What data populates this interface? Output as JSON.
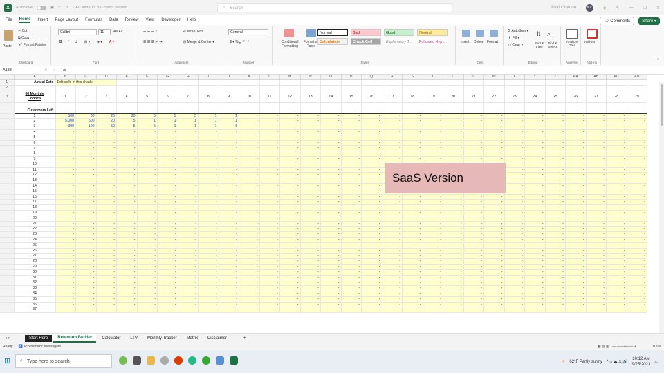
{
  "titlebar": {
    "autosave": "AutoSave",
    "autosave_state": "Off",
    "filename": "CAC and LTV v3 - SaaS Version",
    "search_placeholder": "Search",
    "user_name": "Kevin Vernon",
    "user_initials": "KV"
  },
  "menu": {
    "tabs": [
      "File",
      "Home",
      "Insert",
      "Page Layout",
      "Formulas",
      "Data",
      "Review",
      "View",
      "Developer",
      "Help"
    ],
    "active": "Home",
    "comments": "Comments",
    "share": "Share"
  },
  "ribbon": {
    "clipboard": {
      "label": "Clipboard",
      "paste": "Paste",
      "cut": "Cut",
      "copy": "Copy",
      "format_painter": "Format Painter"
    },
    "font": {
      "label": "Font",
      "name": "Calibri",
      "size": "11"
    },
    "alignment": {
      "label": "Alignment",
      "wrap": "Wrap Text",
      "merge": "Merge & Center"
    },
    "number": {
      "label": "Number",
      "format": "General"
    },
    "styles": {
      "label": "Styles",
      "conditional": "Conditional Formatting",
      "format_as_table": "Format as Table",
      "normal": "Normal",
      "bad": "Bad",
      "good": "Good",
      "neutral": "Neutral",
      "calculation": "Calculation",
      "check_cell": "Check Cell",
      "explanatory": "Explanatory T...",
      "followed": "Followed Hyp..."
    },
    "cells": {
      "label": "Cells",
      "insert": "Insert",
      "delete": "Delete",
      "format": "Format"
    },
    "editing": {
      "label": "Editing",
      "autosum": "AutoSum",
      "fill": "Fill",
      "clear": "Clear",
      "sort": "Sort & Filter",
      "find": "Find & Select"
    },
    "analysis": {
      "label": "Analysis",
      "analyze": "Analyze Data"
    },
    "addins": {
      "label": "Add-ins",
      "addins": "Add-ins"
    }
  },
  "formula_bar": {
    "name_box": "A138",
    "fx": "fx",
    "content": ""
  },
  "sheet": {
    "col_headers": [
      "A",
      "B",
      "C",
      "D",
      "E",
      "F",
      "G",
      "H",
      "I",
      "J",
      "K",
      "L",
      "M",
      "N",
      "O",
      "P",
      "Q",
      "R",
      "S",
      "T",
      "U",
      "V",
      "W",
      "X",
      "Y",
      "Z",
      "AA",
      "AB",
      "AC",
      "AD"
    ],
    "row1_label": "Actual Date",
    "row1_note": "Edit cells in this shade.",
    "row3_label_1": "60 Monthly",
    "row3_label_2": "Cohorts",
    "cohort_numbers": [
      "1",
      "2",
      "3",
      "4",
      "5",
      "6",
      "7",
      "8",
      "9",
      "10",
      "11",
      "12",
      "13",
      "14",
      "15",
      "16",
      "17",
      "18",
      "19",
      "20",
      "21",
      "22",
      "23",
      "24",
      "25",
      "26",
      "27",
      "28",
      "29"
    ],
    "section_label": "Customers Left",
    "data_rows": [
      [
        "500",
        "30",
        "25",
        "20",
        "5",
        "5",
        "5",
        "1",
        "1"
      ],
      [
        "5,000",
        "500",
        "20",
        "5",
        "1",
        "1",
        "1",
        "1",
        "1"
      ],
      [
        "300",
        "100",
        "50",
        "5",
        "5",
        "1",
        "1",
        "1",
        "1"
      ]
    ],
    "empty_value": "-",
    "cohort_row_count": 37
  },
  "overlay": {
    "text": "SaaS Version"
  },
  "sheet_tabs": {
    "items": [
      "Start Here",
      "Retention Builder",
      "Calculator",
      "LTV",
      "Monthly Tracker",
      "Matrix",
      "Disclaimer"
    ],
    "active": "Retention Builder",
    "add": "+"
  },
  "status": {
    "ready": "Ready",
    "accessibility": "Accessibility: Investigate",
    "zoom": "100%"
  },
  "taskbar": {
    "search_placeholder": "Type here to search",
    "weather": "62°F Partly sunny",
    "time": "10:12 AM",
    "date": "9/25/2023"
  }
}
